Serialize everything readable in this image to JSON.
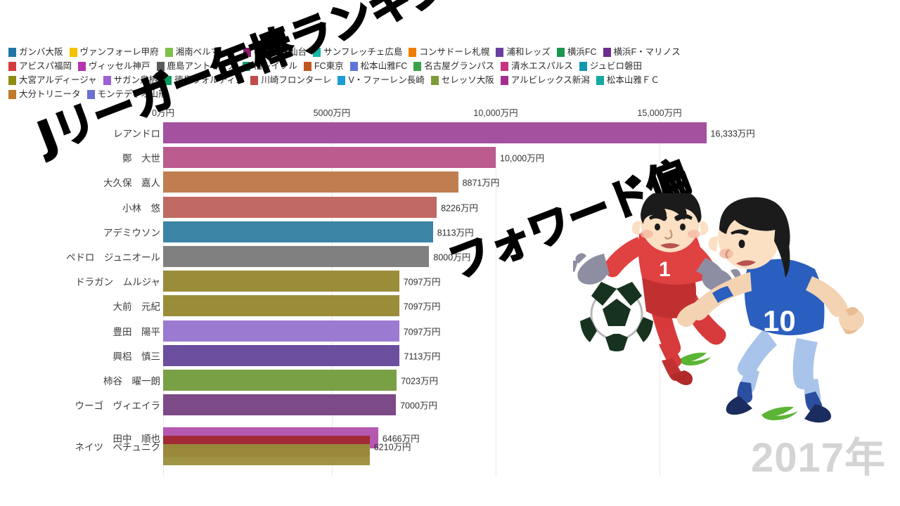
{
  "title_handwriting_line1": "Jリーガー年棒ランキング",
  "title_handwriting_line2": "フォワード偏",
  "year_label": "2017年",
  "legend": {
    "rows": [
      [
        {
          "label": "ガンバ大阪",
          "color": "#1f77a8"
        },
        {
          "label": "ヴァンフォーレ甲府",
          "color": "#f2c200"
        },
        {
          "label": "湘南ベルマーレ",
          "color": "#7cc04a"
        },
        {
          "label": "ベガルタ仙台",
          "color": "#8f1d6e"
        },
        {
          "label": "サンフレッチェ広島",
          "color": "#18b6a5"
        },
        {
          "label": "コンサドーレ札幌",
          "color": "#ef7d00"
        },
        {
          "label": "浦和レッズ",
          "color": "#6a3fa0"
        },
        {
          "label": "横浜FC",
          "color": "#19974e"
        },
        {
          "label": "横浜F・マリノス",
          "color": "#6b2d8c"
        }
      ],
      [
        {
          "label": "アビスパ福岡",
          "color": "#d33c3c"
        },
        {
          "label": "ヴィッセル神戸",
          "color": "#b535b0"
        },
        {
          "label": "鹿島アントラーズ",
          "color": "#5b5b5b"
        },
        {
          "label": "柏レイソル",
          "color": "#0f9d6e"
        },
        {
          "label": "FC東京",
          "color": "#c2561f"
        },
        {
          "label": "松本山雅FC",
          "color": "#5f74d6"
        },
        {
          "label": "名古屋グランパス",
          "color": "#3aa14a"
        },
        {
          "label": "清水エスパルス",
          "color": "#c8357e"
        },
        {
          "label": "ジュビロ磐田",
          "color": "#1496ae"
        }
      ],
      [
        {
          "label": "大宮アルディージャ",
          "color": "#8f8b12"
        },
        {
          "label": "サガン鳥栖",
          "color": "#9b62d4"
        },
        {
          "label": "徳島ヴォルティス",
          "color": "#069a5e"
        },
        {
          "label": "川崎フロンターレ",
          "color": "#c24a4a"
        },
        {
          "label": "V・ファーレン長崎",
          "color": "#1a9ed4"
        },
        {
          "label": "セレッソ大阪",
          "color": "#7d9b37"
        },
        {
          "label": "アルビレックス新潟",
          "color": "#a62f8e"
        },
        {
          "label": "松本山雅ＦＣ",
          "color": "#17a8a0"
        }
      ],
      [
        {
          "label": "大分トリニータ",
          "color": "#c07a29"
        },
        {
          "label": "モンテディオ山形",
          "color": "#6a6fd4"
        }
      ]
    ]
  },
  "chart_data": {
    "type": "bar",
    "orientation": "horizontal",
    "title": "Jリーガー年棒ランキング フォワード偏",
    "xlabel": "",
    "ylabel": "",
    "xlim": [
      0,
      17500
    ],
    "grid": true,
    "legend_position": "top",
    "unit": "万円",
    "axis_ticks": [
      {
        "value": 0,
        "label": "0万円",
        "x": 232
      },
      {
        "value": 5000,
        "label": "5000万円",
        "x": 472
      },
      {
        "value": 10000,
        "label": "10,000万円",
        "x": 705
      },
      {
        "value": 15000,
        "label": "15,000万円",
        "x": 938
      }
    ],
    "categories": [
      "レアンドロ",
      "鄭　大世",
      "大久保　嘉人",
      "小林　悠",
      "アデミウソン",
      "ペドロ　ジュニオール",
      "ドラガン　ムルジャ",
      "大前　元紀",
      "豊田　陽平",
      "興梠　慎三",
      "柿谷　曜一朗",
      "ウーゴ　ヴィエイラ"
    ],
    "values": [
      16333,
      10000,
      8871,
      8226,
      8113,
      8000,
      7097,
      7097,
      7097,
      7113,
      7023,
      7000
    ],
    "value_labels": [
      "16,333万円",
      "10,000万円",
      "8871万円",
      "8226万円",
      "8113万円",
      "8000万円",
      "7097万円",
      "7097万円",
      "7097万円",
      "7113万円",
      "7023万円",
      "7000万円"
    ],
    "bar_colors": [
      "#a4519f",
      "#bc5c8e",
      "#c07e50",
      "#c16a63",
      "#3c84a6",
      "#808080",
      "#9a8d3a",
      "#9a8d3a",
      "#9b7ad1",
      "#6b4e9e",
      "#79a045",
      "#7c4a86"
    ],
    "transition_rows": [
      {
        "name": "田中　順也",
        "value": 6466,
        "value_label": "6466万円",
        "color": "#b050ab"
      },
      {
        "name": "ネイツ　ペチュニク",
        "value": 6210,
        "value_label": "6210万円",
        "color": "#a0282f"
      },
      {
        "name": "",
        "value": 6210,
        "value_label": "",
        "color": "#9a8d3a"
      }
    ]
  }
}
